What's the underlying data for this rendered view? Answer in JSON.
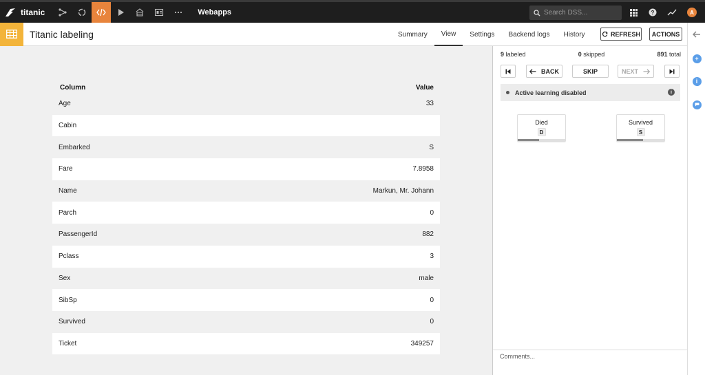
{
  "app": {
    "project_name": "titanic",
    "nav_label": "Webapps",
    "search_placeholder": "Search DSS...",
    "avatar_letter": "A"
  },
  "icons": {
    "logo": "dataiku-bird-icon",
    "nav": [
      "flow-icon",
      "recycle-icon",
      "code-icon",
      "play-icon",
      "deploy-icon",
      "dashboard-icon",
      "more-icon"
    ],
    "right": [
      "apps-grid-icon",
      "help-icon",
      "activity-icon",
      "avatar"
    ]
  },
  "header": {
    "title": "Titanic labeling",
    "tabs": [
      "Summary",
      "View",
      "Settings",
      "Backend logs",
      "History"
    ],
    "active_tab": "View",
    "refresh_label": "REFRESH",
    "actions_label": "ACTIONS"
  },
  "record": {
    "col_header": "Column",
    "val_header": "Value",
    "rows": [
      {
        "column": "Age",
        "value": "33"
      },
      {
        "column": "Cabin",
        "value": ""
      },
      {
        "column": "Embarked",
        "value": "S"
      },
      {
        "column": "Fare",
        "value": "7.8958"
      },
      {
        "column": "Name",
        "value": "Markun, Mr. Johann"
      },
      {
        "column": "Parch",
        "value": "0"
      },
      {
        "column": "PassengerId",
        "value": "882"
      },
      {
        "column": "Pclass",
        "value": "3"
      },
      {
        "column": "Sex",
        "value": "male"
      },
      {
        "column": "SibSp",
        "value": "0"
      },
      {
        "column": "Survived",
        "value": "0"
      },
      {
        "column": "Ticket",
        "value": "349257"
      }
    ]
  },
  "labeling": {
    "labeled_count": "9",
    "labeled_text": "labeled",
    "skipped_count": "0",
    "skipped_text": "skipped",
    "total_count": "891",
    "total_text": "total",
    "back_label": "BACK",
    "skip_label": "SKIP",
    "next_label": "NEXT",
    "active_learning_text": "Active learning disabled",
    "labels": [
      {
        "name": "Died",
        "key": "D",
        "fraction": 0.45
      },
      {
        "name": "Survived",
        "key": "S",
        "fraction": 0.55
      }
    ],
    "comments_placeholder": "Comments..."
  },
  "colors": {
    "accent": "#e8843c",
    "webapp_icon": "#f3b43a",
    "rail_blue": "#5b9ee8",
    "nav_bg": "#1e1e1e"
  }
}
